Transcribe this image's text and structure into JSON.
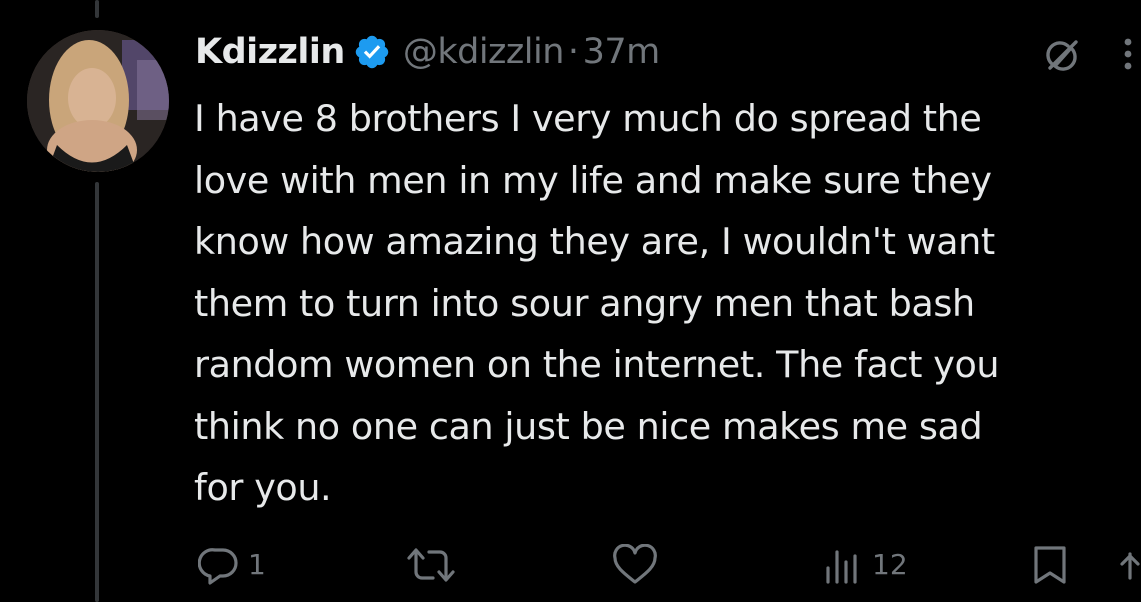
{
  "tweet": {
    "display_name": "Kdizzlin",
    "verified": true,
    "handle": "@kdizzlin",
    "separator": "·",
    "timestamp": "37m",
    "text_lines": [
      "I have 8 brothers I very much do spread the",
      "love with men in my life and make sure they",
      "know how amazing they are, I wouldn't want",
      "them to turn into sour angry men that bash",
      "random women on the internet. The fact you",
      "think no one can just be nice makes me sad",
      "for you."
    ]
  },
  "actions": {
    "reply_count": "1",
    "retweet_count": "",
    "like_count": "",
    "views_count": "12"
  },
  "icons": {
    "verified": "verified-badge-icon",
    "grok": "grok-icon",
    "more": "more-icon",
    "reply": "reply-icon",
    "retweet": "retweet-icon",
    "like": "like-icon",
    "views": "views-icon",
    "bookmark": "bookmark-icon",
    "share": "share-icon"
  },
  "colors": {
    "background": "#000000",
    "text_primary": "#e7e9ea",
    "text_secondary": "#71767b",
    "verified_blue": "#1d9bf0",
    "thread_line": "#333639"
  }
}
